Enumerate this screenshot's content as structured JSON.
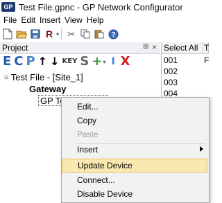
{
  "window": {
    "title": "Test File.gpnc - GP Network Configurator",
    "app_icon_text": "GP"
  },
  "menubar": {
    "items": [
      "File",
      "Edit",
      "Insert",
      "View",
      "Help"
    ]
  },
  "toolbar": {
    "buttons": [
      {
        "name": "new-file-icon"
      },
      {
        "name": "open-folder-icon"
      },
      {
        "name": "save-icon"
      },
      {
        "name": "run-icon",
        "label": "R"
      },
      {
        "name": "cut-icon"
      },
      {
        "name": "copy-icon"
      },
      {
        "name": "paste-icon"
      },
      {
        "name": "help-icon"
      }
    ]
  },
  "project_panel": {
    "title": "Project",
    "controls": {
      "pin": "⊞",
      "close": "×"
    },
    "toolbar": [
      {
        "name": "e-button",
        "label": "E",
        "color": "#1f5fad"
      },
      {
        "name": "c-button",
        "label": "C",
        "color": "#1f5fad"
      },
      {
        "name": "p-button",
        "label": "P",
        "color": "#4b86c7"
      },
      {
        "name": "up-arrow-icon",
        "label": "↑",
        "color": "#000000"
      },
      {
        "name": "down-arrow-icon",
        "label": "↓",
        "color": "#000000"
      },
      {
        "name": "key-button",
        "label": "KEY",
        "color": "#333333"
      },
      {
        "name": "s-button",
        "label": "S",
        "color": "#666666"
      },
      {
        "name": "add-icon",
        "label": "+",
        "color": "#3a9a3a"
      },
      {
        "name": "cursor-icon",
        "label": "I",
        "color": "#3d7fd6"
      },
      {
        "name": "delete-icon",
        "label": "X",
        "color": "#d61f1f"
      }
    ],
    "tree": [
      {
        "text": "Test File - [Site_1]",
        "expander": "⊟",
        "level": 0
      },
      {
        "text": "Gateway",
        "expander": "",
        "level": 1,
        "bold": true
      },
      {
        "text": "GP Temperature",
        "expander": "",
        "level": 2
      }
    ]
  },
  "right_panel": {
    "columns": [
      "Select All",
      "T"
    ],
    "rows": [
      {
        "id": "001",
        "col2": "F"
      },
      {
        "id": "002",
        "col2": ""
      },
      {
        "id": "003",
        "col2": ""
      },
      {
        "id": "004",
        "col2": ""
      }
    ]
  },
  "context_menu": {
    "items": [
      {
        "label": "Edit...",
        "disabled": false
      },
      {
        "label": "Copy",
        "disabled": false
      },
      {
        "label": "Paste",
        "disabled": true
      },
      {
        "separator": true
      },
      {
        "label": "Insert",
        "submenu": true,
        "disabled": false
      },
      {
        "separator": true
      },
      {
        "label": "Update Device",
        "highlight": true,
        "disabled": false
      },
      {
        "label": "Connect...",
        "disabled": false
      },
      {
        "label": "Disable Device",
        "disabled": false
      }
    ]
  }
}
